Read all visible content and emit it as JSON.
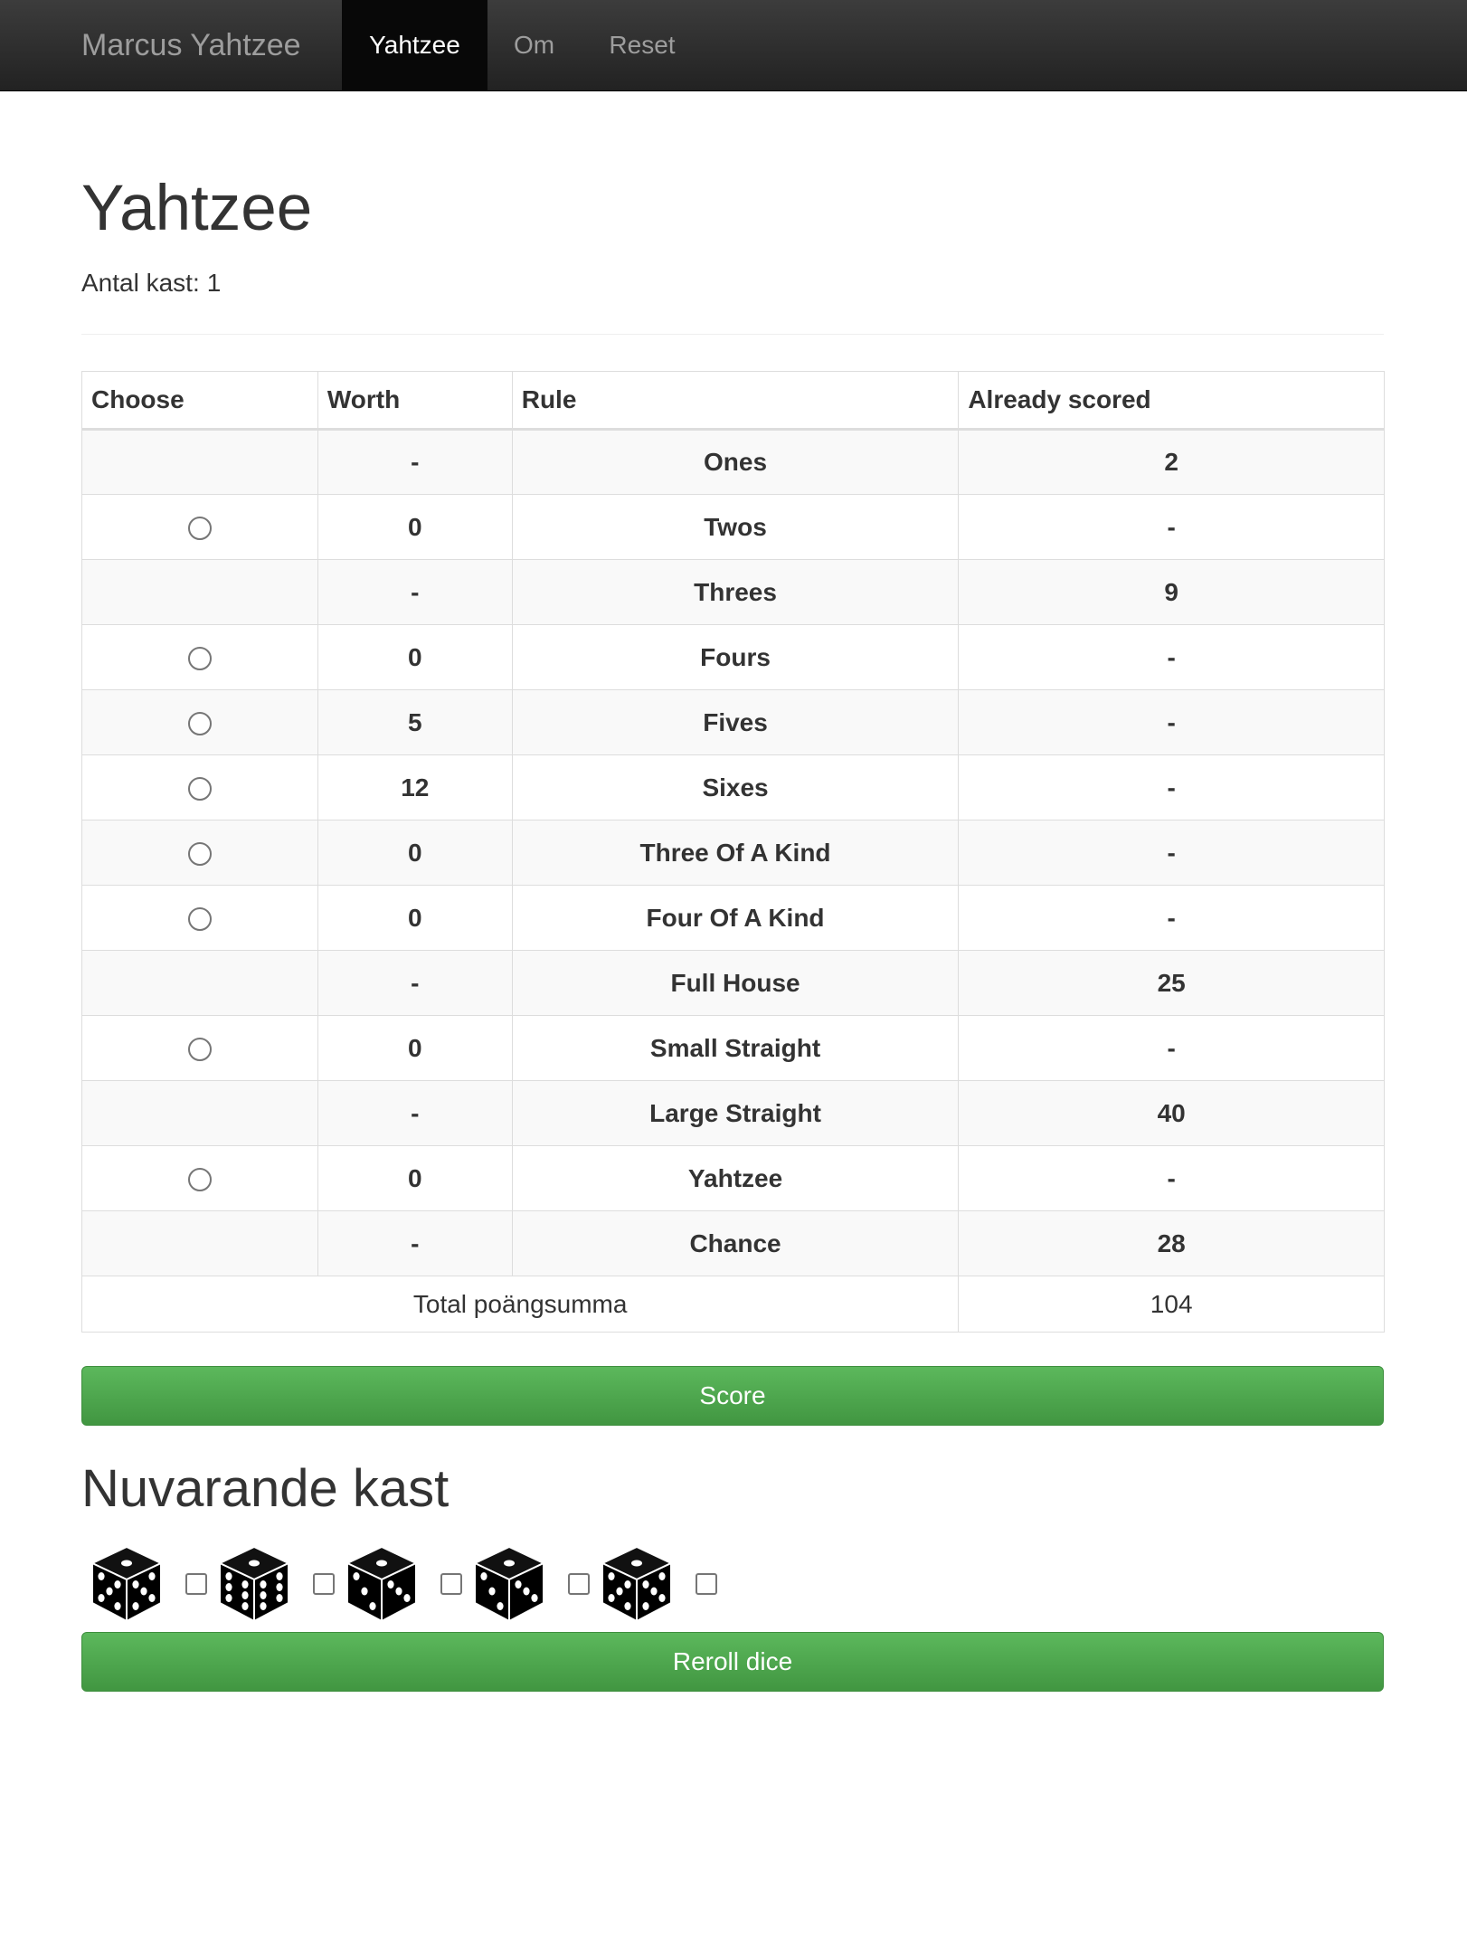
{
  "navbar": {
    "brand": "Marcus Yahtzee",
    "items": [
      {
        "label": "Yahtzee",
        "active": true
      },
      {
        "label": "Om",
        "active": false
      },
      {
        "label": "Reset",
        "active": false
      }
    ]
  },
  "page": {
    "title": "Yahtzee",
    "roll_label": "Antal kast:",
    "roll_count": "1"
  },
  "table": {
    "headers": [
      "Choose",
      "Worth",
      "Rule",
      "Already scored"
    ],
    "rows": [
      {
        "choosable": false,
        "worth": "-",
        "rule": "Ones",
        "scored": "2"
      },
      {
        "choosable": true,
        "worth": "0",
        "rule": "Twos",
        "scored": "-"
      },
      {
        "choosable": false,
        "worth": "-",
        "rule": "Threes",
        "scored": "9"
      },
      {
        "choosable": true,
        "worth": "0",
        "rule": "Fours",
        "scored": "-"
      },
      {
        "choosable": true,
        "worth": "5",
        "rule": "Fives",
        "scored": "-"
      },
      {
        "choosable": true,
        "worth": "12",
        "rule": "Sixes",
        "scored": "-"
      },
      {
        "choosable": true,
        "worth": "0",
        "rule": "Three Of A Kind",
        "scored": "-"
      },
      {
        "choosable": true,
        "worth": "0",
        "rule": "Four Of A Kind",
        "scored": "-"
      },
      {
        "choosable": false,
        "worth": "-",
        "rule": "Full House",
        "scored": "25"
      },
      {
        "choosable": true,
        "worth": "0",
        "rule": "Small Straight",
        "scored": "-"
      },
      {
        "choosable": false,
        "worth": "-",
        "rule": "Large Straight",
        "scored": "40"
      },
      {
        "choosable": true,
        "worth": "0",
        "rule": "Yahtzee",
        "scored": "-"
      },
      {
        "choosable": false,
        "worth": "-",
        "rule": "Chance",
        "scored": "28"
      }
    ],
    "total_label": "Total poängsumma",
    "total_value": "104"
  },
  "buttons": {
    "score": "Score",
    "reroll": "Reroll dice"
  },
  "current_roll": {
    "heading": "Nuvarande kast",
    "dice": [
      {
        "icon": "die-five-icon",
        "held": false
      },
      {
        "icon": "die-six-icon",
        "held": false
      },
      {
        "icon": "die-three-icon",
        "held": false
      },
      {
        "icon": "die-three-icon",
        "held": false
      },
      {
        "icon": "die-five-icon",
        "held": false
      }
    ]
  },
  "colors": {
    "navbar": "#222222",
    "active_nav": "#080808",
    "button_green": "#5cb85c",
    "stripe": "#f9f9f9"
  }
}
